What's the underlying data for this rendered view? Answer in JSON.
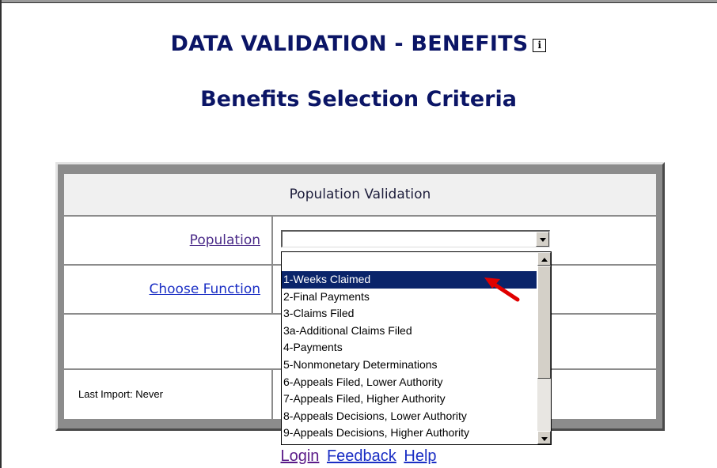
{
  "page": {
    "title": "DATA VALIDATION - BENEFITS",
    "info_icon": "i",
    "subtitle": "Benefits Selection Criteria"
  },
  "form": {
    "section_header": "Population Validation",
    "population_label": "Population",
    "population_value": "",
    "choose_function_label": "Choose Function",
    "last_import": "Last Import: Never"
  },
  "dropdown": {
    "options": [
      "1-Weeks Claimed",
      "2-Final Payments",
      "3-Claims Filed",
      "3a-Additional Claims Filed",
      "4-Payments",
      "5-Nonmonetary Determinations",
      "6-Appeals Filed, Lower Authority",
      "7-Appeals Filed, Higher Authority",
      "8-Appeals Decisions, Lower Authority",
      "9-Appeals Decisions, Higher Authority"
    ],
    "selected": "1-Weeks Claimed"
  },
  "footer": {
    "login": "Login",
    "feedback": "Feedback",
    "help": "Help"
  },
  "colors": {
    "title": "#0b1566",
    "selection": "#0a246a",
    "arrow": "#e00000",
    "panel": "#8c8c8c"
  }
}
